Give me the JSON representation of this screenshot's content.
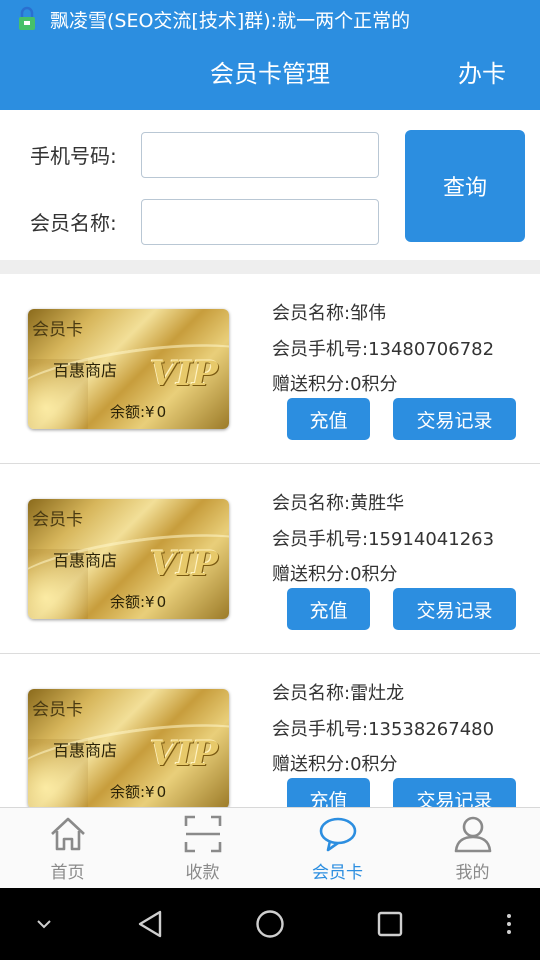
{
  "status_bar": {
    "notification_text": "飘凌雪(SEO交流[技术]群):就一两个正常的"
  },
  "app_bar": {
    "title": "会员卡管理",
    "action_label": "办卡"
  },
  "search": {
    "phone_label": "手机号码:",
    "phone_value": "",
    "name_label": "会员名称:",
    "name_value": "",
    "query_label": "查询"
  },
  "members": [
    {
      "card_type": "会员卡",
      "store_name": "百惠商店",
      "balance_label": "余额:¥",
      "balance": "0",
      "name_label": "会员名称:",
      "name": "邹伟",
      "phone_label": "会员手机号:",
      "phone": "13480706782",
      "points_label": "赠送积分:",
      "points": "0积分",
      "recharge_label": "充值",
      "records_label": "交易记录"
    },
    {
      "card_type": "会员卡",
      "store_name": "百惠商店",
      "balance_label": "余额:¥",
      "balance": "0",
      "name_label": "会员名称:",
      "name": "黄胜华",
      "phone_label": "会员手机号:",
      "phone": "15914041263",
      "points_label": "赠送积分:",
      "points": "0积分",
      "recharge_label": "充值",
      "records_label": "交易记录"
    },
    {
      "card_type": "会员卡",
      "store_name": "百惠商店",
      "balance_label": "余额:¥",
      "balance": "0",
      "name_label": "会员名称:",
      "name": "雷灶龙",
      "phone_label": "会员手机号:",
      "phone": "13538267480",
      "points_label": "赠送积分:",
      "points": "0积分",
      "recharge_label": "充值",
      "records_label": "交易记录"
    }
  ],
  "card_logo": "VIP",
  "tabs": [
    {
      "label": "首页",
      "icon": "home-icon",
      "active": false
    },
    {
      "label": "收款",
      "icon": "scan-icon",
      "active": false
    },
    {
      "label": "会员卡",
      "icon": "chat-bubble-icon",
      "active": true
    },
    {
      "label": "我的",
      "icon": "user-icon",
      "active": false
    }
  ],
  "colors": {
    "primary": "#2c8ee0",
    "tab_inactive": "#8a8a8a"
  }
}
